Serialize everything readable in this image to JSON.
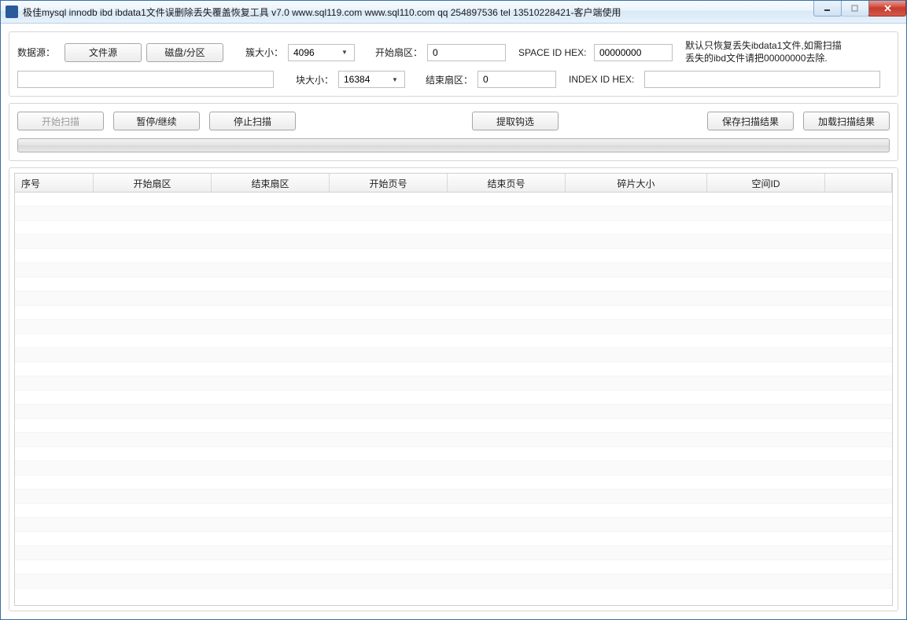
{
  "window": {
    "title": "极佳mysql innodb ibd ibdata1文件误删除丢失覆盖恢复工具 v7.0 www.sql119.com www.sql110.com qq 254897536 tel 13510228421-客户端使用"
  },
  "topPanel": {
    "dataSourceLabel": "数据源：",
    "fileSourceBtn": "文件源",
    "diskPartitionBtn": "磁盘/分区",
    "dataSourcePath": "",
    "clusterSizeLabel": "簇大小：",
    "clusterSizeValue": "4096",
    "blockSizeLabel": "块大小：",
    "blockSizeValue": "16384",
    "startSectorLabel": "开始扇区：",
    "startSectorValue": "0",
    "endSectorLabel": "结束扇区：",
    "endSectorValue": "0",
    "spaceIdHexLabel": "SPACE ID HEX:",
    "spaceIdHexValue": "00000000",
    "indexIdHexLabel": "INDEX ID HEX:",
    "indexIdHexValue": "",
    "hintText": "默认只恢复丢失ibdata1文件,如需扫描丢失的ibd文件请把00000000去除."
  },
  "actions": {
    "startScan": "开始扫描",
    "pauseResume": "暂停/继续",
    "stopScan": "停止扫描",
    "extractChecked": "提取钩选",
    "saveResults": "保存扫描结果",
    "loadResults": "加载扫描结果"
  },
  "table": {
    "columns": [
      "序号",
      "开始扇区",
      "结束扇区",
      "开始页号",
      "结束页号",
      "碎片大小",
      "空间ID",
      ""
    ]
  }
}
